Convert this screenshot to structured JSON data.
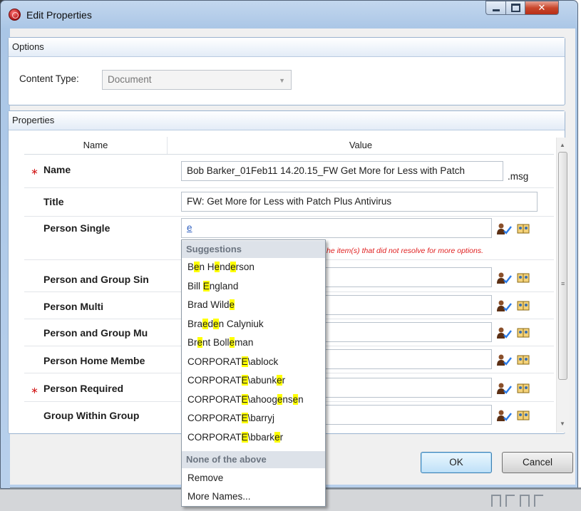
{
  "window": {
    "title": "Edit Properties"
  },
  "options": {
    "header": "Options",
    "content_type_label": "Content Type:",
    "content_type_value": "Document"
  },
  "properties": {
    "header": "Properties",
    "col_name": "Name",
    "col_value": "Value",
    "rows": [
      {
        "label": "Name",
        "required": true,
        "value": "Bob Barker_01Feb11 14.20.15_FW Get More for Less with Patch",
        "suffix": ".msg"
      },
      {
        "label": "Title",
        "required": false,
        "value": "FW: Get More for Less with Patch Plus Antivirus"
      },
      {
        "label": "Person Single",
        "required": false,
        "value": "e",
        "error": "he item(s) that did not resolve for more options."
      },
      {
        "label": "Person and Group Sin",
        "required": false,
        "value": ""
      },
      {
        "label": "Person Multi",
        "required": false,
        "value": ""
      },
      {
        "label": "Person and Group Mu",
        "required": false,
        "value": ""
      },
      {
        "label": "Person Home Membe",
        "required": false,
        "value": ""
      },
      {
        "label": "Person Required",
        "required": true,
        "value": ""
      },
      {
        "label": "Group Within Group",
        "required": false,
        "value": ""
      }
    ]
  },
  "suggestions": {
    "header": "Suggestions",
    "items": [
      {
        "parts": [
          "B",
          "e",
          "n H",
          "e",
          "nd",
          "e",
          "rson"
        ]
      },
      {
        "parts": [
          "Bill ",
          "E",
          "ngland"
        ]
      },
      {
        "parts": [
          "Brad Wild",
          "e"
        ]
      },
      {
        "parts": [
          "Bra",
          "e",
          "d",
          "e",
          "n Calyniuk"
        ]
      },
      {
        "parts": [
          "Br",
          "e",
          "nt Boll",
          "e",
          "man"
        ]
      },
      {
        "parts": [
          "CORPORAT",
          "E",
          "\\ablock"
        ]
      },
      {
        "parts": [
          "CORPORAT",
          "E",
          "\\abunk",
          "e",
          "r"
        ]
      },
      {
        "parts": [
          "CORPORAT",
          "E",
          "\\ahoog",
          "e",
          "ns",
          "e",
          "n"
        ]
      },
      {
        "parts": [
          "CORPORAT",
          "E",
          "\\barryj"
        ]
      },
      {
        "parts": [
          "CORPORAT",
          "E",
          "\\bbark",
          "e",
          "r"
        ]
      }
    ],
    "none_header": "None of the above",
    "remove_label": "Remove",
    "more_names_label": "More Names..."
  },
  "buttons": {
    "ok": "OK",
    "cancel": "Cancel"
  },
  "colors": {
    "highlight": "#ffff00",
    "required_star": "#d42020",
    "error_text": "#e02020"
  },
  "icons": {
    "person_check": "person-check-icon",
    "address_book": "address-book-icon"
  }
}
